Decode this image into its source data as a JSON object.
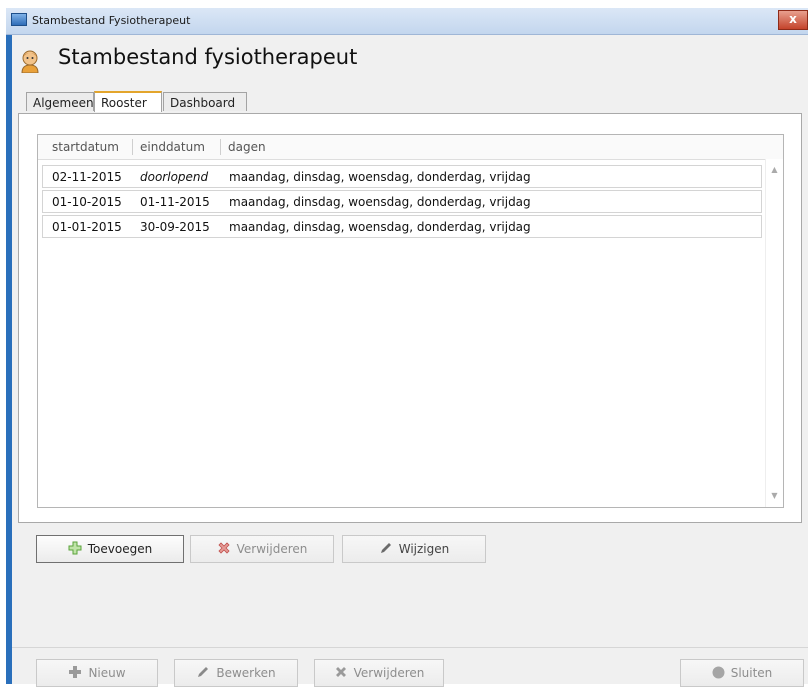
{
  "window": {
    "title": "Stambestand Fysiotherapeut",
    "close_label": "x"
  },
  "header": {
    "title": "Stambestand fysiotherapeut"
  },
  "tabs": [
    {
      "label": "Algemeen",
      "active": false
    },
    {
      "label": "Rooster",
      "active": true
    },
    {
      "label": "Dashboard",
      "active": false
    }
  ],
  "table": {
    "columns": [
      "startdatum",
      "einddatum",
      "dagen"
    ],
    "rows": [
      {
        "startdatum": "02-11-2015",
        "einddatum": "doorlopend",
        "dagen": "maandag, dinsdag, woensdag, donderdag, vrijdag"
      },
      {
        "startdatum": "01-10-2015",
        "einddatum": "01-11-2015",
        "dagen": "maandag, dinsdag, woensdag, donderdag, vrijdag"
      },
      {
        "startdatum": "01-01-2015",
        "einddatum": "30-09-2015",
        "dagen": "maandag, dinsdag, woensdag, donderdag, vrijdag"
      }
    ]
  },
  "tab_buttons": {
    "add": "Toevoegen",
    "delete": "Verwijderen",
    "edit": "Wijzigen"
  },
  "footer_buttons": {
    "new": "Nieuw",
    "edit": "Bewerken",
    "delete": "Verwijderen",
    "close": "Sluiten"
  },
  "colors": {
    "frame": "#2a6fbb",
    "active_tab_accent": "#e3a52c",
    "add_icon": "#5aa33a",
    "delete_icon": "#c0504d"
  },
  "icons": {
    "window": "app-window-icon",
    "header": "therapist-avatar-icon",
    "add": "plus-icon",
    "delete": "x-icon",
    "edit": "pencil-icon",
    "close": "circle-icon"
  }
}
